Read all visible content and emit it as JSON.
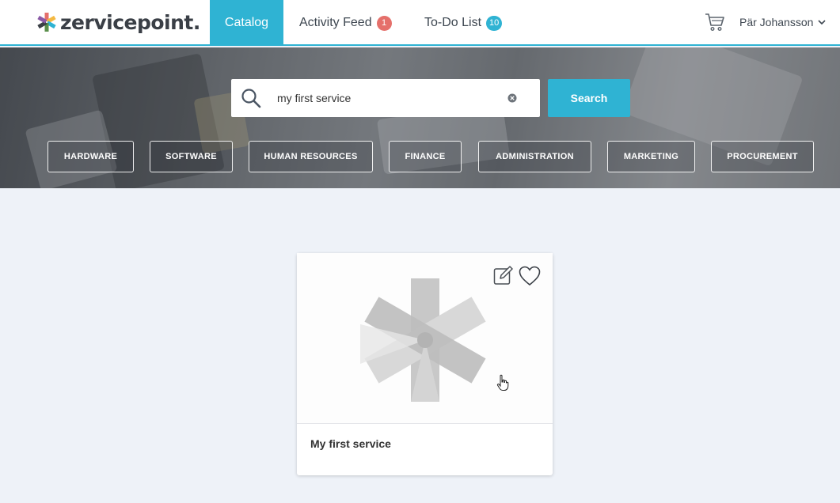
{
  "brand": {
    "name": "zervicepoint."
  },
  "nav": {
    "tabs": [
      {
        "label": "Catalog",
        "active": true
      },
      {
        "label": "Activity Feed",
        "badge": "1"
      },
      {
        "label": "To-Do List",
        "badge": "10"
      }
    ],
    "cart_icon": "cart-icon",
    "user_name": "Pär Johansson"
  },
  "search": {
    "value": "my first service",
    "button_label": "Search"
  },
  "categories": [
    "HARDWARE",
    "SOFTWARE",
    "HUMAN RESOURCES",
    "FINANCE",
    "ADMINISTRATION",
    "MARKETING",
    "PROCUREMENT"
  ],
  "service_card": {
    "title": "My first service",
    "icons": [
      "edit-icon",
      "heart-icon"
    ]
  },
  "colors": {
    "accent": "#2fb3d3",
    "badge_red": "#e5706b"
  }
}
